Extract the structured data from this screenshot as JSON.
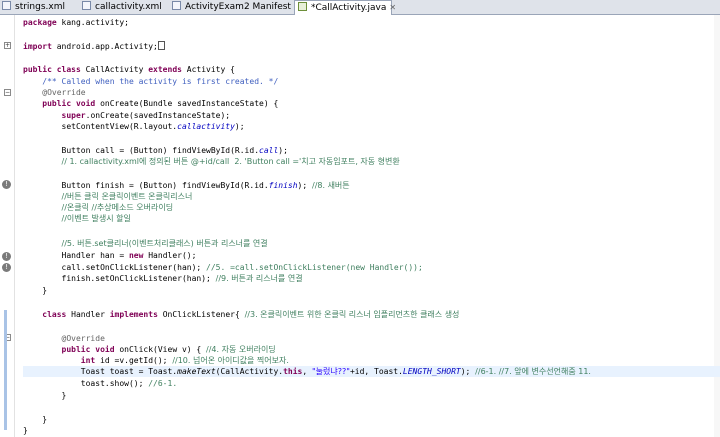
{
  "tabs": [
    {
      "label": "strings.xml",
      "icon": "xml-file-icon"
    },
    {
      "label": "callactivity.xml",
      "icon": "xml-file-icon"
    },
    {
      "label": "ActivityExam2 Manifest",
      "icon": "manifest-file-icon"
    },
    {
      "label": "*CallActivity.java",
      "icon": "java-file-icon",
      "active": true
    }
  ],
  "tab_close_glyph": "✕",
  "code": {
    "package": "package kang.activity;",
    "import": "import android.app.Activity;",
    "class_decl": "public class CallActivity extends Activity {",
    "javadoc": "/** Called when the activity is first created. */",
    "override": "@Override",
    "oncreate_decl": "public void onCreate(Bundle savedInstanceState) {",
    "super_call": "super.onCreate(savedInstanceState);",
    "set_content": "setContentView(R.layout.callactivity);",
    "call_decl": "Button call = (Button) findViewById(R.id.call);",
    "comment1": "// 1. callactivity.xml에 정의된 버튼 @+id/call  2. 'Button call ='치고 자동임포트, 자동 형변환",
    "finish_decl": "Button finish = (Button) findViewById(R.id.finish);",
    "comment8": "//8. 새버튼",
    "comment_click1": "//버튼 클릭 온클릭이벤트 온클릭리스너",
    "comment_click2": "//온클릭 //추상메소드 오버라이딩",
    "comment_click3": "//이벤트 발생시 할일",
    "comment5": "//5. 버튼.set클리너(이벤트처리클래스) 버튼과 리스너를 연결",
    "handler_new": "Handler han = new Handler();",
    "call_set": "call.setOnClickListener(han);",
    "comment_call_set": "//5. =call.setOnClickListener(new Handler());",
    "finish_set": "finish.setOnClickListener(han);",
    "comment9": "//9. 버튼과 리스너를 연결",
    "close_brace": "}",
    "handler_class": "class Handler implements OnClickListener{",
    "comment3": "//3. 온클릭이벤트 위한 온클릭 리스너 임플리먼츠한 클래스 생성",
    "onclick_decl": "public void onClick(View v) {",
    "comment4": "//4. 자동 오버라이딩",
    "id_line": "int id =v.getId();",
    "comment10": "//10. 넘어온 아이디값을 찍어보자.",
    "toast_line": "Toast toast = Toast.makeText(CallActivity.this, \"눌렀냐??\"+id, Toast.LENGTH_SHORT);",
    "comment_toast": "//6-1. //7. 앞에 변수선언해줌 11.",
    "show_line": "toast.show();",
    "comment_show": "//6-1."
  }
}
